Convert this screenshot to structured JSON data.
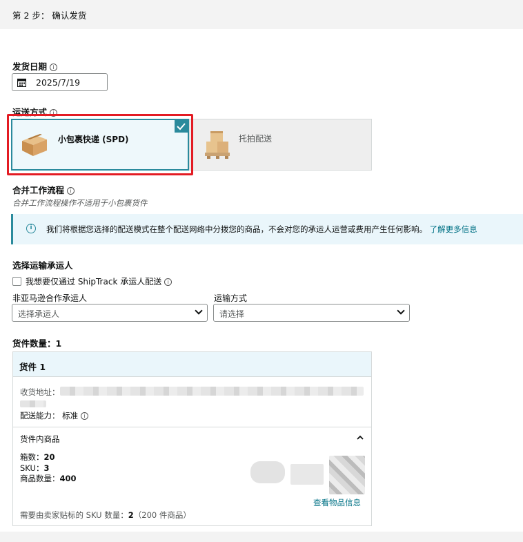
{
  "step_title": "第 2 步： 确认发货",
  "ship_date": {
    "label": "发货日期",
    "value": "2025/7/19"
  },
  "shipping_mode": {
    "label": "运送方式",
    "options": [
      {
        "label": "小包裹快递 (SPD)",
        "selected": true
      },
      {
        "label": "托拍配送",
        "selected": false
      }
    ]
  },
  "workflow": {
    "label": "合并工作流程",
    "note": "合并工作流程操作不适用于小包裹货件"
  },
  "alert": {
    "text": "我们将根据您选择的配送模式在整个配送网络中分拨您的商品，不会对您的承运人运营或费用产生任何影响。",
    "link": "了解更多信息"
  },
  "carrier": {
    "label": "选择运输承运人",
    "shiptrack_checkbox": "我想要仅通过 ShipTrack 承运人配送",
    "carrier_label": "非亚马逊合作承运人",
    "carrier_placeholder": "选择承运人",
    "method_label": "运输方式",
    "method_placeholder": "请选择"
  },
  "shipment_count": "货件数量：1",
  "shipment": {
    "title": "货件 1",
    "address_label": "收货地址：",
    "capability_label": "配送能力：",
    "capability_value": "标准",
    "items_header": "货件内商品",
    "boxes_label": "箱数：",
    "boxes_value": "20",
    "sku_label": "SKU：",
    "sku_value": "3",
    "qty_label": "商品数量：",
    "qty_value": "400",
    "view_items": "查看物品信息",
    "seller_label_prefix": "需要由卖家贴标的 SKU 数量：",
    "seller_label_count": "2",
    "seller_label_suffix": "（200 件商品）"
  },
  "colors": {
    "accent": "#2a8a9c",
    "highlight": "#e31b23",
    "link": "#007185"
  },
  "icons": [
    "info-icon",
    "calendar-icon",
    "checkmark-icon",
    "box-icon",
    "pallet-icon",
    "chevron-down-icon",
    "chevron-up-icon"
  ]
}
